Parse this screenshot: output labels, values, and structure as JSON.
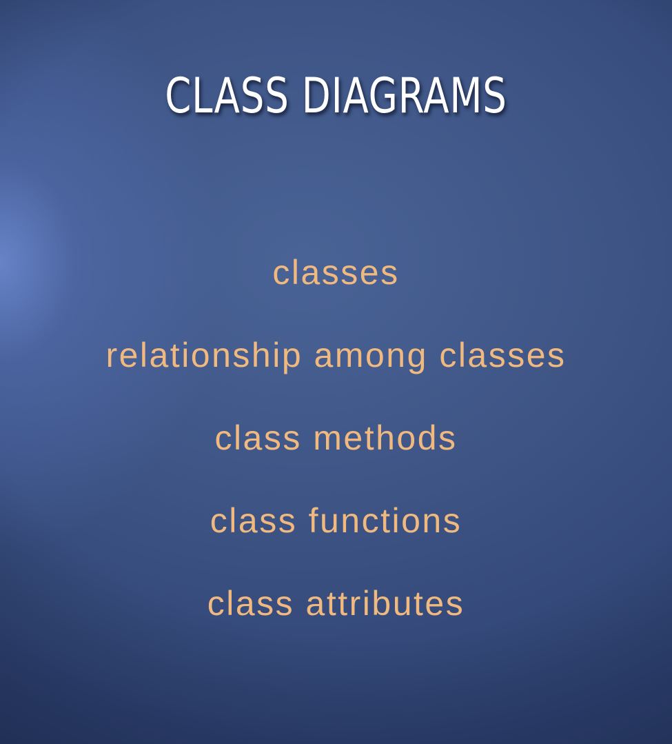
{
  "slide": {
    "title": "CLASS DIAGRAMS",
    "topics": [
      "classes",
      "relationship among classes",
      "class methods",
      "class functions",
      "class attributes"
    ]
  },
  "colors": {
    "background": "#3f5687",
    "title": "#ffffff",
    "topic_text": "#f0b97f"
  }
}
